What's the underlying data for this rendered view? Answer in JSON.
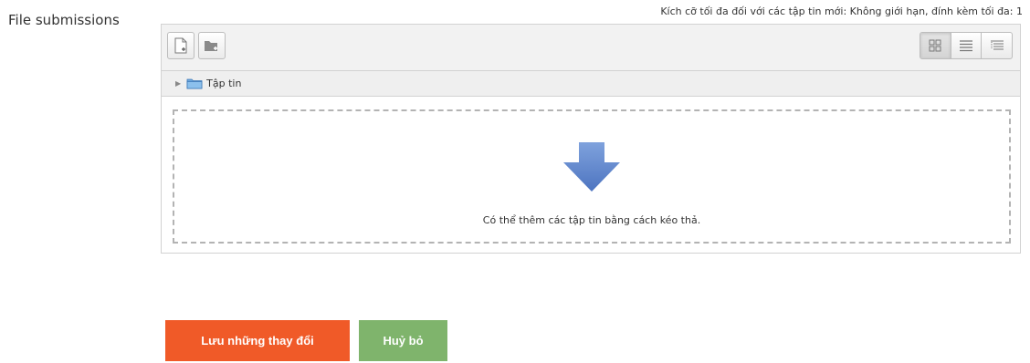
{
  "form": {
    "field_label": "File submissions",
    "limits_text": "Kích cỡ tối đa đối với các tập tin mới: Không giới hạn, đính kèm tối đa: 1"
  },
  "filemanager": {
    "toolbar": {
      "add_file_icon": "add-file-icon",
      "add_folder_icon": "add-folder-icon",
      "views": [
        "icons-view",
        "list-view",
        "tree-view"
      ],
      "active_view": "icons-view"
    },
    "path": {
      "folder_label": "Tập tin"
    },
    "dropzone": {
      "message": "Có thể thêm các tập tin bằng cách kéo thả."
    }
  },
  "buttons": {
    "save_label": "Lưu những thay đổi",
    "cancel_label": "Huỷ bỏ"
  },
  "colors": {
    "save": "#f05a28",
    "cancel": "#7fb46c",
    "arrow": "#6d8fcf"
  }
}
